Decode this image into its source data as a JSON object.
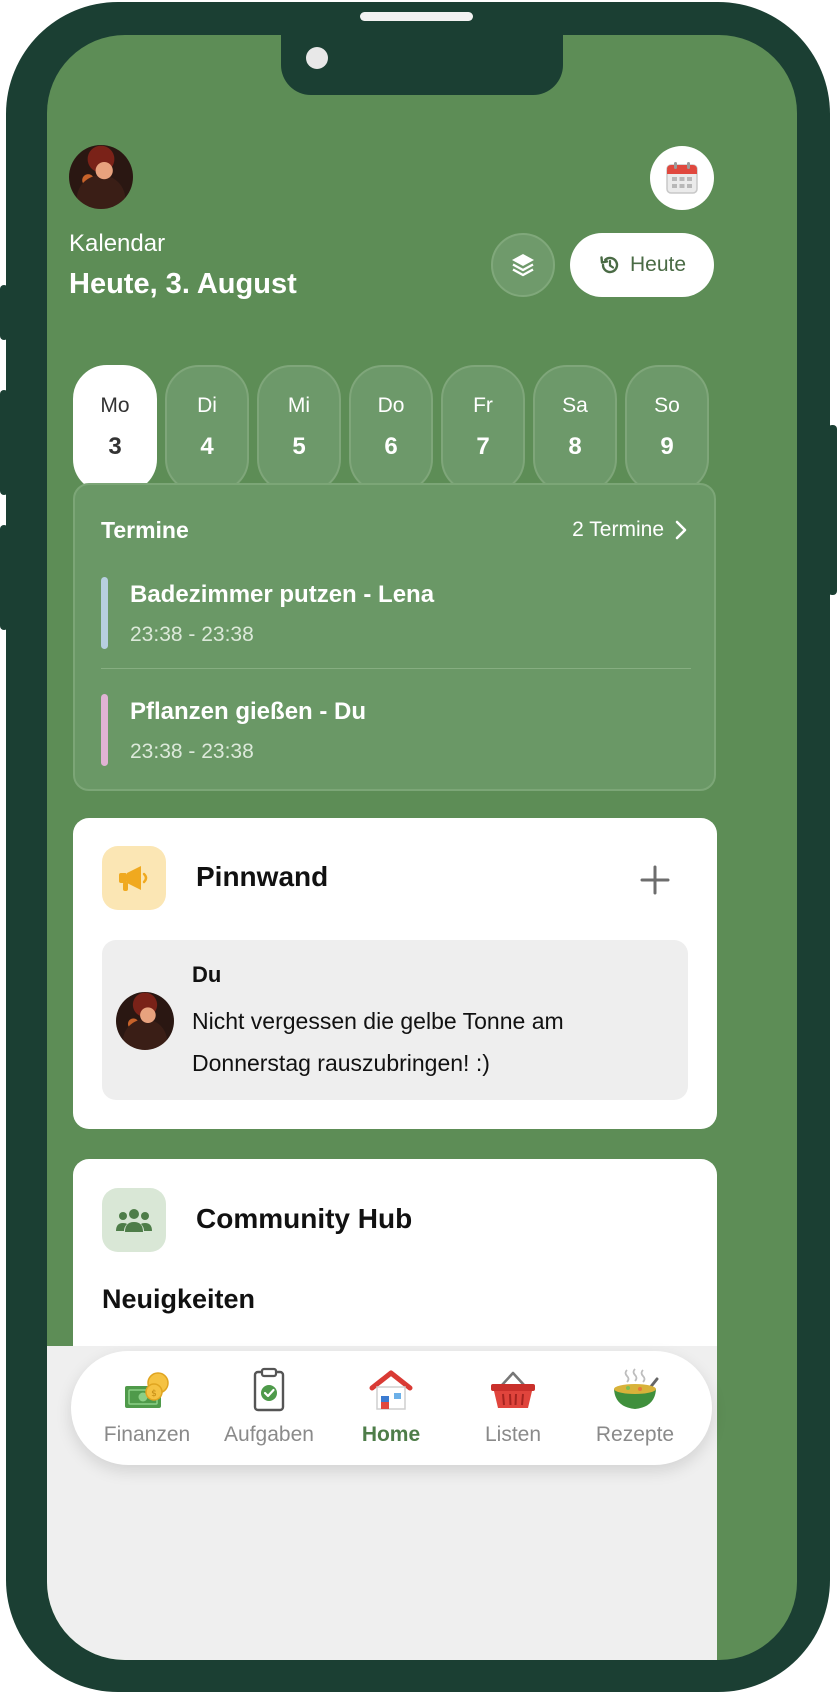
{
  "header": {
    "section_label": "Kalendar",
    "date_title": "Heute, 3. August",
    "today_button": "Heute",
    "calendar_icon": "calendar-icon",
    "layers_icon": "layers-icon",
    "history_icon": "history-icon"
  },
  "week": [
    {
      "name": "Mo",
      "num": "3",
      "selected": true
    },
    {
      "name": "Di",
      "num": "4",
      "selected": false
    },
    {
      "name": "Mi",
      "num": "5",
      "selected": false
    },
    {
      "name": "Do",
      "num": "6",
      "selected": false
    },
    {
      "name": "Fr",
      "num": "7",
      "selected": false
    },
    {
      "name": "Sa",
      "num": "8",
      "selected": false
    },
    {
      "name": "So",
      "num": "9",
      "selected": false
    }
  ],
  "appointments": {
    "title": "Termine",
    "count_label": "2 Termine",
    "items": [
      {
        "title": "Badezimmer putzen - Lena",
        "time": "23:38 - 23:38",
        "color": "#b7cfe0"
      },
      {
        "title": "Pflanzen gießen - Du",
        "time": "23:38 - 23:38",
        "color": "#e0b3d4"
      }
    ]
  },
  "pinboard": {
    "title": "Pinnwand",
    "icon": "megaphone-icon",
    "add_icon": "plus-icon",
    "note": {
      "author": "Du",
      "line1": "Nicht vergessen die gelbe Tonne am",
      "line2": "Donnerstag rauszubringen! :)"
    }
  },
  "community": {
    "title": "Community Hub",
    "icon": "people-icon",
    "subtitle": "Neuigkeiten"
  },
  "nav": {
    "items": [
      {
        "label": "Finanzen",
        "icon": "money-icon",
        "active": false
      },
      {
        "label": "Aufgaben",
        "icon": "clipboard-icon",
        "active": false
      },
      {
        "label": "Home",
        "icon": "house-icon",
        "active": true
      },
      {
        "label": "Listen",
        "icon": "basket-icon",
        "active": false
      },
      {
        "label": "Rezepte",
        "icon": "soup-bowl-icon",
        "active": false
      }
    ]
  },
  "colors": {
    "screen_bg": "#5d8d56",
    "frame": "#1b3f33",
    "accent": "#4e7d49"
  }
}
